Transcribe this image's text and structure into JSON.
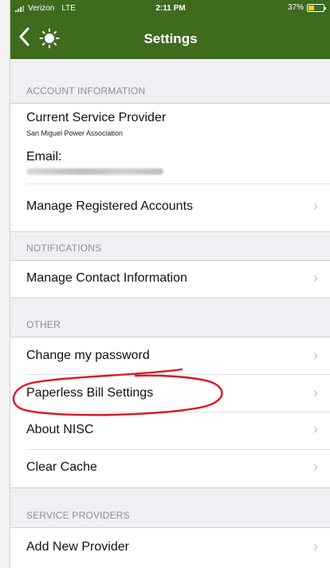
{
  "status_bar": {
    "carrier": "Verizon",
    "network": "LTE",
    "time": "2:11 PM",
    "battery": "37%",
    "battery_level": 0.37,
    "battery_color": "#f5d31a"
  },
  "nav_bar": {
    "title": "Settings",
    "back_icon": "chevron-left-icon",
    "logo_icon": "sun-logo-icon",
    "color": "#3f6b1f"
  },
  "sections": {
    "account": {
      "header": "ACCOUNT INFORMATION",
      "current_provider_label": "Current Service Provider",
      "current_provider_value": "San Miguel Power Association",
      "email_label": "Email:",
      "manage_accounts": "Manage Registered Accounts"
    },
    "notifications": {
      "header": "NOTIFICATIONS",
      "manage_contact": "Manage Contact Information"
    },
    "other": {
      "header": "OTHER",
      "change_password": "Change my password",
      "paperless": "Paperless Bill Settings",
      "about": "About NISC",
      "clear_cache": "Clear Cache"
    },
    "service_providers": {
      "header": "SERVICE PROVIDERS",
      "add_provider": "Add New Provider"
    }
  },
  "chevron": "›",
  "annotation": {
    "color": "#e0141e",
    "target": "paperless"
  }
}
